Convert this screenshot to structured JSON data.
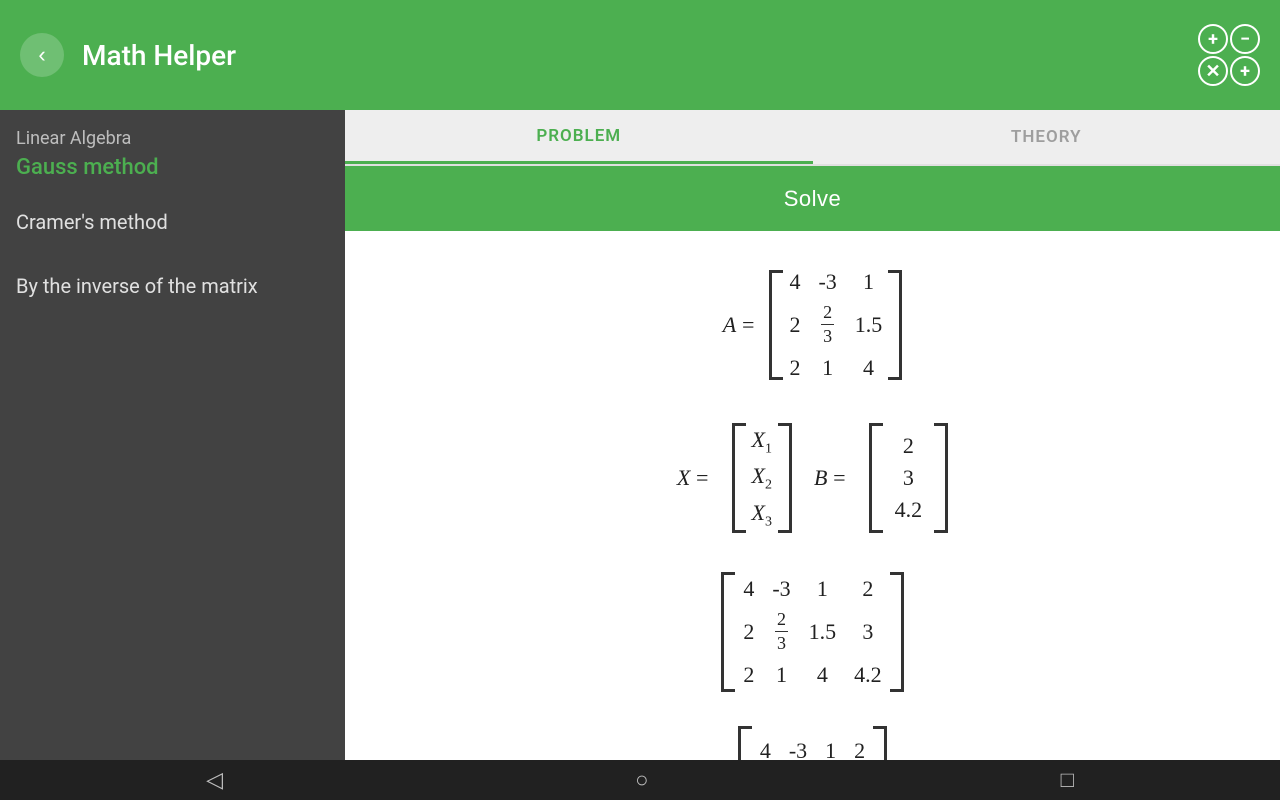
{
  "appTitle": "Math Helper",
  "topIcons": [
    "+",
    "-",
    "✕",
    "+"
  ],
  "sidebar": {
    "category": "Linear Algebra",
    "activeItem": "Gauss method",
    "items": [
      {
        "label": "Cramer's method"
      },
      {
        "label": "By the inverse of the matrix"
      }
    ]
  },
  "tabs": [
    {
      "label": "PROBLEM",
      "active": true
    },
    {
      "label": "THEORY",
      "active": false
    }
  ],
  "solveButton": "Solve",
  "matrixA": {
    "label": "A =",
    "rows": [
      [
        "4",
        "-3",
        "1"
      ],
      [
        "2",
        "2/3",
        "1.5"
      ],
      [
        "2",
        "1",
        "4"
      ]
    ]
  },
  "vectorX": {
    "label": "X =",
    "rows": [
      "X₁",
      "X₂",
      "X₃"
    ]
  },
  "vectorB": {
    "label": "B =",
    "rows": [
      "2",
      "3",
      "4.2"
    ]
  },
  "augmented1": {
    "rows": [
      [
        "4",
        "-3",
        "1",
        "2"
      ],
      [
        "2",
        "2/3",
        "1.5",
        "3"
      ],
      [
        "2",
        "1",
        "4",
        "4.2"
      ]
    ]
  },
  "augmented2": {
    "rows": [
      [
        "4",
        "-3",
        "1",
        "2"
      ]
    ]
  },
  "bottomNav": {
    "back": "◁",
    "home": "○",
    "square": "□"
  }
}
